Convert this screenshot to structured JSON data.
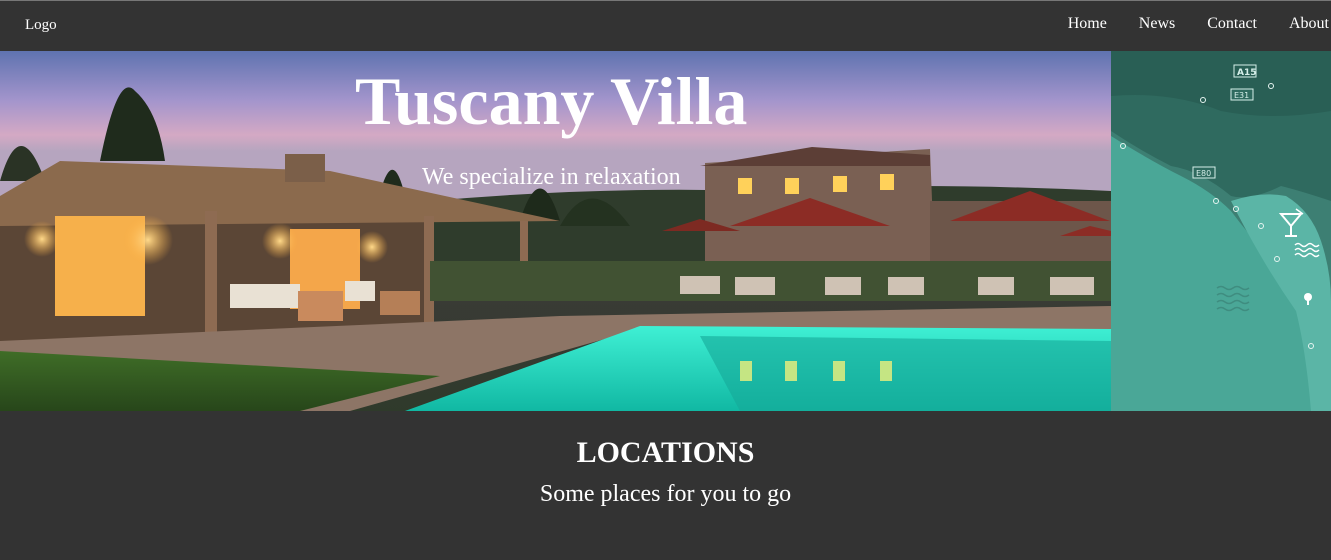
{
  "header": {
    "logo": "Logo",
    "nav": [
      {
        "label": "Home"
      },
      {
        "label": "News"
      },
      {
        "label": "Contact"
      },
      {
        "label": "About"
      }
    ]
  },
  "hero": {
    "title": "Tuscany Villa",
    "subtitle": "We specialize in relaxation"
  },
  "map": {
    "road_labels": [
      "A15",
      "E31",
      "E80"
    ],
    "icons": [
      "cocktail-icon",
      "waves-icon",
      "waves-icon",
      "tree-icon"
    ]
  },
  "locations": {
    "title": "LOCATIONS",
    "subtitle": "Some places for you to go"
  }
}
